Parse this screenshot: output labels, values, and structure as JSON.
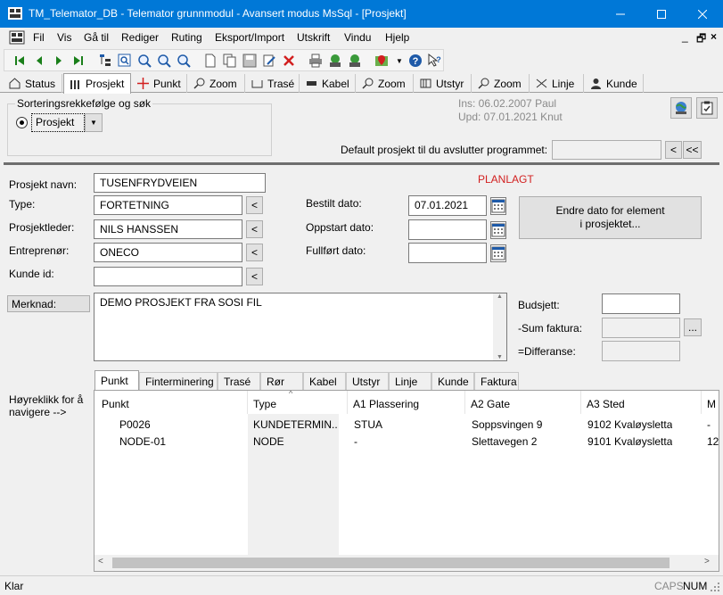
{
  "window": {
    "title": "TM_Telemator_DB - Telemator grunnmodul - Avansert modus MsSql - [Prosjekt]"
  },
  "menu": [
    "Fil",
    "Vis",
    "Gå til",
    "Rediger",
    "Ruting",
    "Eksport/Import",
    "Utskrift",
    "Vindu",
    "Hjelp"
  ],
  "module_tabs": [
    {
      "label": "Status",
      "icon": "status-icon"
    },
    {
      "label": "Prosjekt",
      "icon": "project-icon"
    },
    {
      "label": "Punkt",
      "icon": "point-icon"
    },
    {
      "label": "Zoom",
      "icon": "zoom-icon"
    },
    {
      "label": "Trasé",
      "icon": "route-icon"
    },
    {
      "label": "Kabel",
      "icon": "cable-icon"
    },
    {
      "label": "Zoom",
      "icon": "zoom-icon"
    },
    {
      "label": "Utstyr",
      "icon": "equipment-icon"
    },
    {
      "label": "Zoom",
      "icon": "zoom-icon"
    },
    {
      "label": "Linje",
      "icon": "line-icon"
    },
    {
      "label": "Kunde",
      "icon": "customer-icon"
    }
  ],
  "sort": {
    "legend": "Sorteringsrekkefølge og søk",
    "option": "Prosjekt"
  },
  "meta": {
    "ins": "Ins: 06.02.2007 Paul",
    "upd": "Upd: 07.01.2021 Knut"
  },
  "default_project": {
    "label": "Default prosjekt til du avslutter programmet:",
    "value": "",
    "btn_prev": "<",
    "btn_first": "<<"
  },
  "project": {
    "name_label": "Prosjekt navn:",
    "name": "TUSENFRYDVEIEN",
    "status": "PLANLAGT",
    "type_label": "Type:",
    "type": "FORTETNING",
    "leader_label": "Prosjektleder:",
    "leader": "NILS HANSSEN",
    "contractor_label": "Entreprenør:",
    "contractor": "ONECO",
    "customer_label": "Kunde id:",
    "customer": "",
    "lookup_btn": "<"
  },
  "dates": {
    "ordered_label": "Bestilt dato:",
    "ordered": "07.01.2021",
    "start_label": "Oppstart dato:",
    "start": "",
    "done_label": "Fullført dato:",
    "done": ""
  },
  "change_date_button": [
    "Endre dato for element",
    "i prosjektet..."
  ],
  "remark": {
    "label": "Merknad:",
    "text": "DEMO PROSJEKT FRA SOSI FIL"
  },
  "budget": {
    "budget_label": "Budsjett:",
    "sum_label": "-Sum faktura:",
    "diff_label": "=Differanse:",
    "more_btn": "..."
  },
  "hint": [
    "Høyreklikk for å",
    "navigere -->"
  ],
  "data_tabs": [
    "Punkt",
    "Finterminering",
    "Trasé",
    "Rør",
    "Kabel",
    "Utstyr",
    "Linje",
    "Kunde",
    "Faktura"
  ],
  "grid": {
    "columns": [
      "Punkt",
      "Type",
      "A1 Plassering",
      "A2 Gate",
      "A3 Sted",
      "M"
    ],
    "rows": [
      [
        "P0026",
        "KUNDETERMIN...",
        "STUA",
        "Soppsvingen 9",
        "9102 Kvaløysletta",
        "-"
      ],
      [
        "NODE-01",
        "NODE",
        "-",
        "Slettavegen 2",
        "9101 Kvaløysletta",
        "12"
      ]
    ]
  },
  "status": {
    "text": "Klar",
    "caps": "CAPS",
    "num": "NUM"
  }
}
